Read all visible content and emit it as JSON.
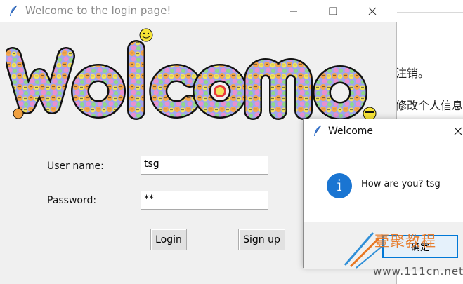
{
  "background_page": {
    "line_1": "注销。",
    "line_2": "修改个人信息"
  },
  "main_window": {
    "title": "Welcome to the login page!",
    "banner_text": "Welcome",
    "form": {
      "username_label": "User name:",
      "username_value": "tsg",
      "password_label": "Password:",
      "password_value": "**"
    },
    "buttons": {
      "login": "Login",
      "signup": "Sign up"
    }
  },
  "dialog": {
    "title": "Welcome",
    "icon": "info-icon",
    "icon_glyph": "i",
    "message": "How are you? tsg",
    "ok_label": "确定"
  },
  "watermark": {
    "brand": "壹聚教程",
    "url": "www.111cn.net"
  },
  "colors": {
    "accent": "#0078d7",
    "info_icon": "#1a75d2",
    "window_bg": "#f0f0f0",
    "watermark_orange": "#e87722"
  }
}
